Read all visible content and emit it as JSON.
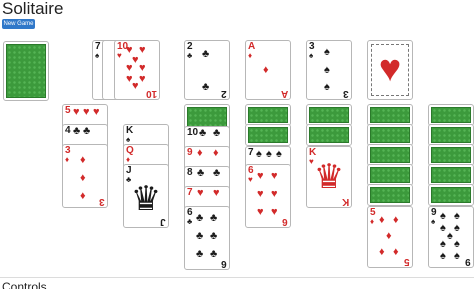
{
  "title": "Solitaire",
  "new_game": "New Game",
  "controls": "Controls",
  "icons": {
    "heart": "♥",
    "diamond": "♦",
    "club": "♣",
    "spade": "♠",
    "crown": "♛"
  },
  "stock": {
    "rank": "",
    "suit": ""
  },
  "waste": [
    {
      "rank": "7",
      "suit": "♠"
    },
    {
      "rank": "10",
      "suit": "♥"
    }
  ],
  "foundations": [
    {
      "rank": "2",
      "suit": "♣"
    },
    {
      "rank": "A",
      "suit": "♦"
    },
    {
      "rank": "3",
      "suit": "♠"
    },
    {
      "rank": "",
      "suit": "♥"
    }
  ],
  "tableau": [
    {
      "cards": [
        {
          "rank": "5",
          "suit": "♥"
        },
        {
          "rank": "4",
          "suit": "♣"
        },
        {
          "rank": "3",
          "suit": "♦"
        }
      ]
    },
    {
      "cards": [
        {
          "rank": "K",
          "suit": "♠"
        },
        {
          "rank": "Q",
          "suit": "♦"
        },
        {
          "rank": "J",
          "suit": "♣"
        }
      ]
    },
    {
      "cards": [
        {
          "rank": "10",
          "suit": "♣"
        },
        {
          "rank": "9",
          "suit": "♦"
        },
        {
          "rank": "8",
          "suit": "♣"
        },
        {
          "rank": "7",
          "suit": "♥"
        },
        {
          "rank": "6",
          "suit": "♣"
        }
      ]
    },
    {
      "cards": [
        {
          "rank": "7",
          "suit": "♠"
        },
        {
          "rank": "6",
          "suit": "♥"
        }
      ]
    },
    {
      "cards": [
        {
          "rank": "K",
          "suit": "♥"
        }
      ]
    },
    {
      "cards": [
        {
          "rank": "5",
          "suit": "♦"
        }
      ]
    },
    {
      "cards": [
        {
          "rank": "9",
          "suit": "♠"
        }
      ]
    }
  ]
}
